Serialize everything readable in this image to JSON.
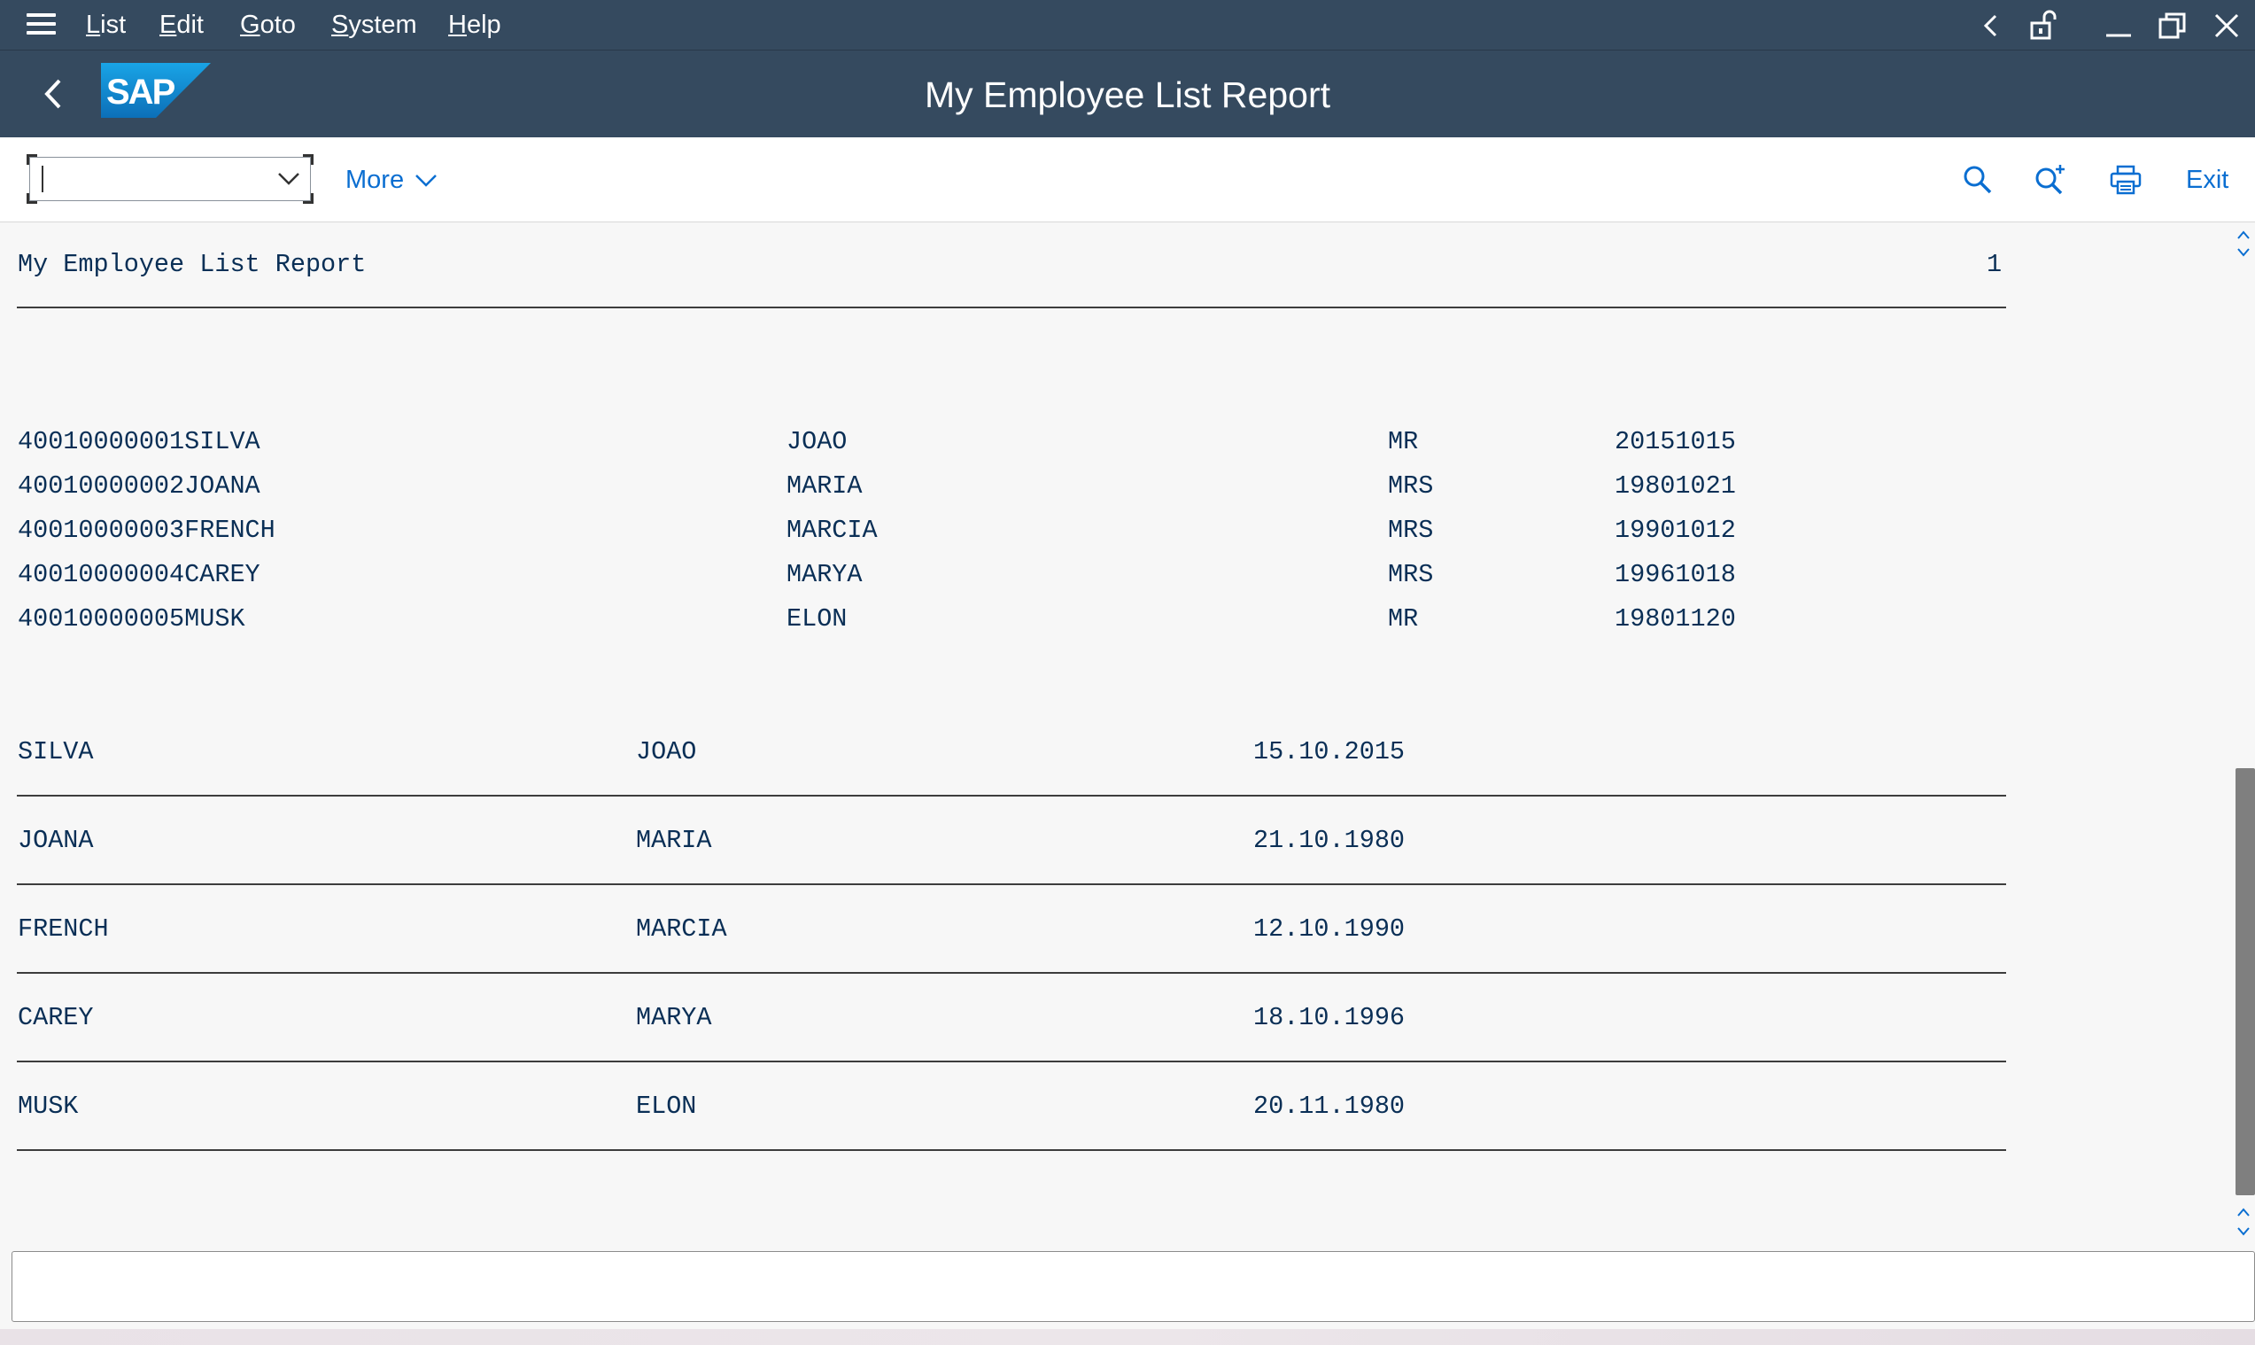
{
  "menu": {
    "items": [
      "List",
      "Edit",
      "Goto",
      "System",
      "Help"
    ]
  },
  "header": {
    "title": "My Employee List Report",
    "logo_text": "SAP"
  },
  "toolbar": {
    "command_field_value": "",
    "more_label": "More",
    "exit_label": "Exit",
    "icons": [
      "search-icon",
      "search-next-icon",
      "print-icon"
    ]
  },
  "report": {
    "title": "My Employee List Report",
    "page_number": "1",
    "raw_rows": [
      {
        "id_name": "40010000001SILVA",
        "first": "JOAO",
        "title": "MR",
        "date": "20151015"
      },
      {
        "id_name": "40010000002JOANA",
        "first": "MARIA",
        "title": "MRS",
        "date": "19801021"
      },
      {
        "id_name": "40010000003FRENCH",
        "first": "MARCIA",
        "title": "MRS",
        "date": "19901012"
      },
      {
        "id_name": "40010000004CAREY",
        "first": "MARYA",
        "title": "MRS",
        "date": "19961018"
      },
      {
        "id_name": "40010000005MUSK",
        "first": "ELON",
        "title": "MR",
        "date": "19801120"
      }
    ],
    "formatted_rows": [
      {
        "last": "SILVA",
        "first": "JOAO",
        "date": "15.10.2015"
      },
      {
        "last": "JOANA",
        "first": "MARIA",
        "date": "21.10.1980"
      },
      {
        "last": "FRENCH",
        "first": "MARCIA",
        "date": "12.10.1990"
      },
      {
        "last": "CAREY",
        "first": "MARYA",
        "date": "18.10.1996"
      },
      {
        "last": "MUSK",
        "first": "ELON",
        "date": "20.11.1980"
      }
    ]
  },
  "colors": {
    "shell_bar": "#354a5f",
    "accent": "#0a6ed1",
    "list_text": "#0a2f56",
    "logo_blue": "#1a9fde"
  }
}
